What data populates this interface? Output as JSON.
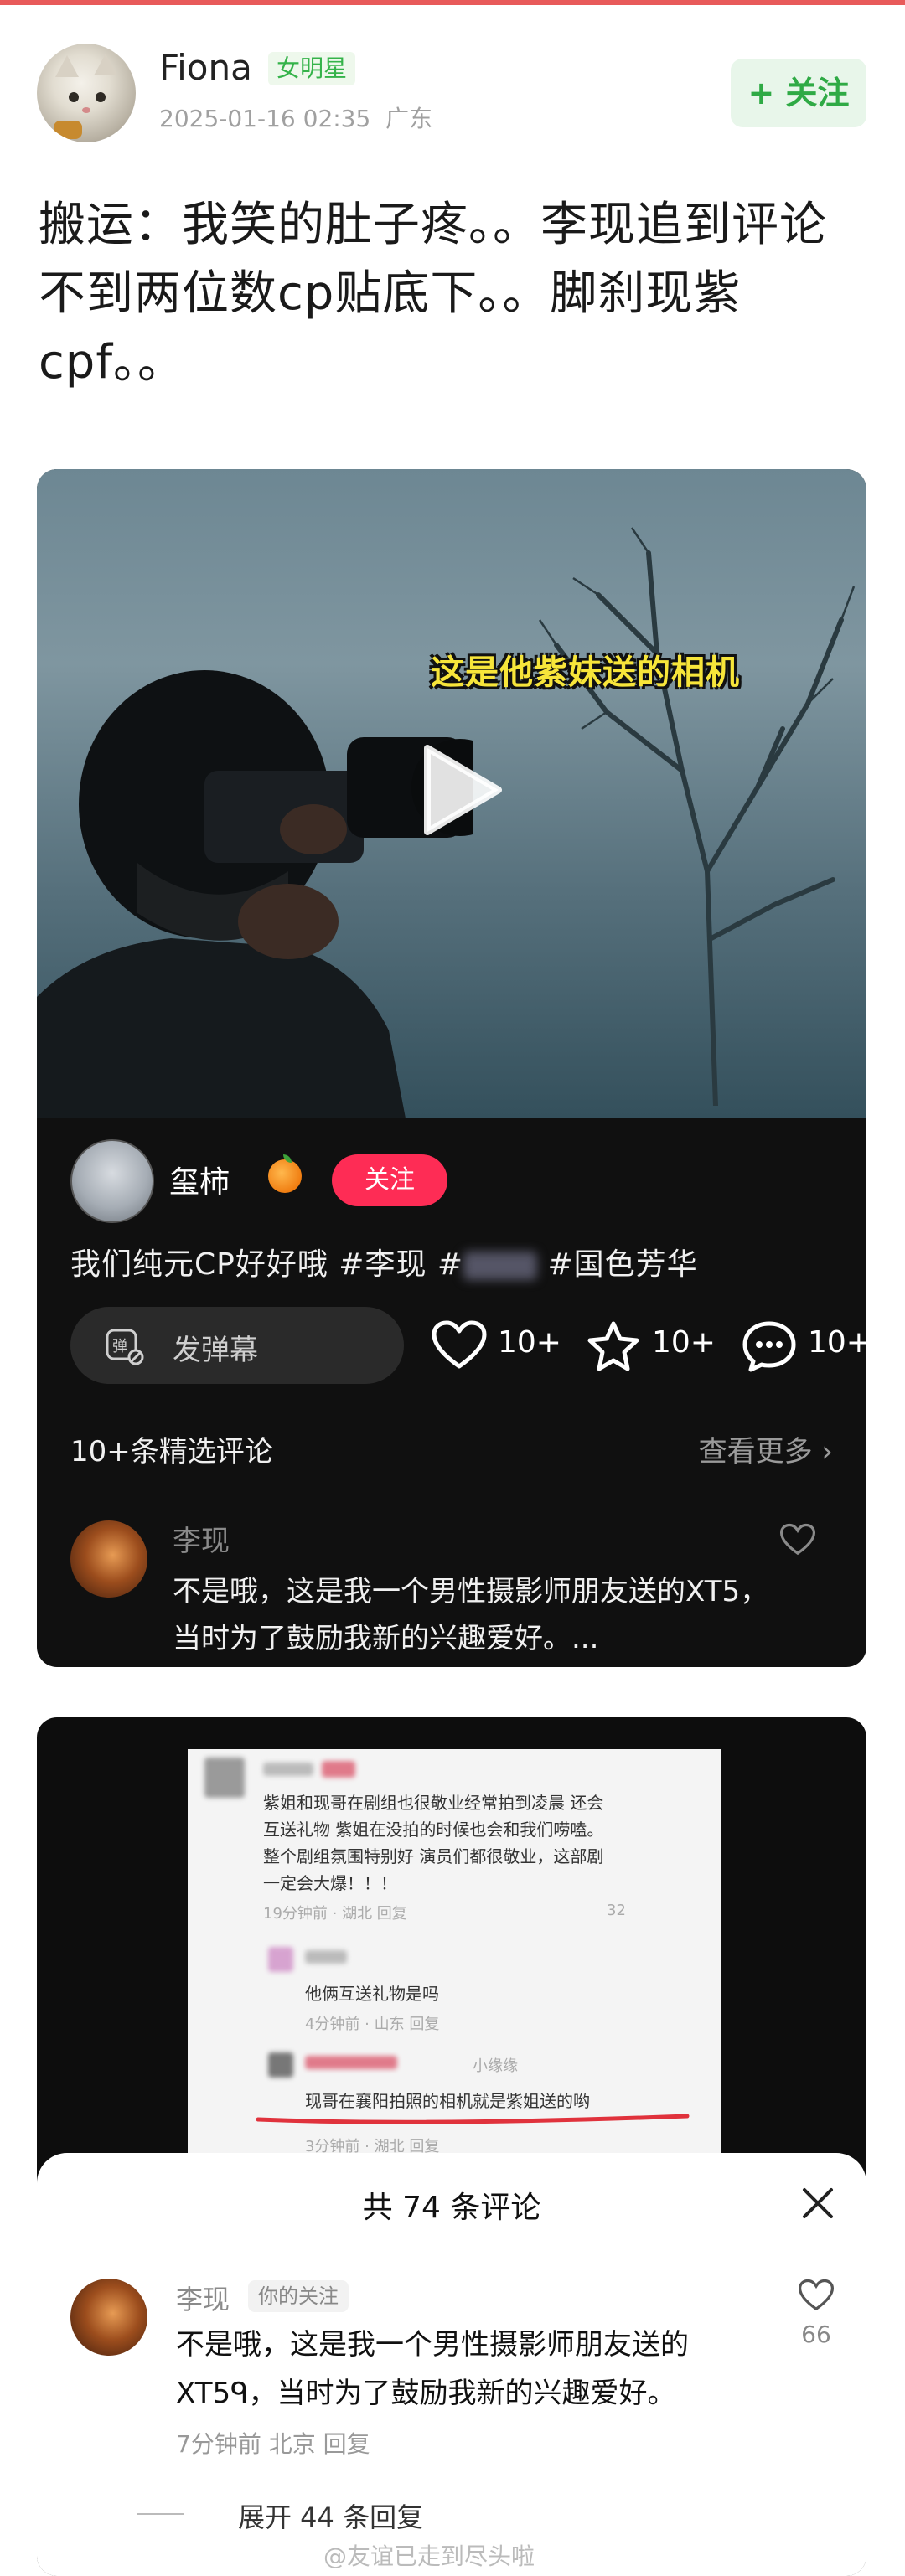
{
  "post": {
    "author": "Fiona",
    "badge": "女明星",
    "datetime": "2025-01-16 02:35",
    "location": "广东",
    "follow_label": "+ 关注",
    "text": "搬运：我笑的肚子疼。。李现追到评论不到两位数cp贴底下。。脚刹现紫cpf。。"
  },
  "video": {
    "overlay_caption": "这是他紫妹送的相机",
    "author": "玺柿",
    "follow_label": "关注",
    "desc_before": "我们纯元CP好好哦  #李现  #",
    "desc_after": "  #国色芳华",
    "danmu_label": "发弹幕",
    "likes": "10+",
    "favorites": "10+",
    "comments_count": "10+",
    "comments_header": "10+条精选评论",
    "see_more": "查看更多 ›",
    "comment": {
      "name": "李现",
      "text": "不是哦，这是我一个男性摄影师朋友送的XT5，当时为了鼓励我新的兴趣爱好。..."
    }
  },
  "inner_screenshot": {
    "c1_line1": "紫姐和现哥在剧组也很敬业经常拍到凌晨 还会",
    "c1_line2": "互送礼物 紫姐在没拍的时候也会和我们唠嗑。",
    "c1_line3": "整个剧组氛围特别好 演员们都很敬业，这部剧",
    "c1_line4": "一定会大爆！！！",
    "c1_meta": "19分钟前 · 湖北   回复",
    "c1_likes": "32",
    "c2_text": "他俩互送礼物是吗",
    "c2_meta": "4分钟前 · 山东   回复",
    "c3_name": "小缘缘",
    "c3_text": "现哥在襄阳拍照的相机就是紫姐送的哟",
    "c3_meta": "3分钟前 · 湖北   回复"
  },
  "sheet": {
    "title": "共 74 条评论",
    "name": "李现",
    "tag": "你的关注",
    "text": "不是哦，这是我一个男性摄影师朋友送的XT5ᑫ，当时为了鼓励我新的兴趣爱好。",
    "meta": "7分钟前 北京 回复",
    "likes": "66",
    "expand": "展开 44 条回复"
  },
  "watermark": "@友谊已走到尽头啦",
  "colors": {
    "follow_green": "#2faa45",
    "douyin_red": "#fe2c55",
    "caption_yellow": "#f7e53a",
    "underline_red": "#e0323c"
  }
}
